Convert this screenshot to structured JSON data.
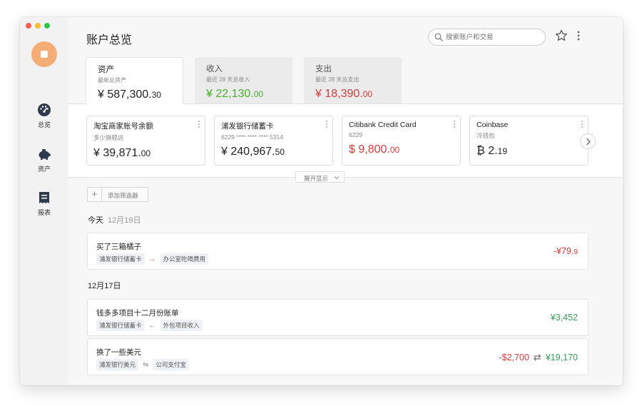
{
  "page_title": "账户总览",
  "search": {
    "placeholder": "搜索账户和交易"
  },
  "sidebar": {
    "items": [
      {
        "label": "总览",
        "icon": "dashboard-gauge-icon"
      },
      {
        "label": "资产",
        "icon": "piggy-bank-icon"
      },
      {
        "label": "报表",
        "icon": "receipt-report-icon"
      }
    ]
  },
  "tabs": [
    {
      "label": "资产",
      "sub": "最新总资产",
      "value_main": "¥ 587,300.",
      "value_dec": "30",
      "active": true
    },
    {
      "label": "收入",
      "sub": "最近 28 天总收入",
      "value_main": "¥ 22,130.",
      "value_dec": "00",
      "active": false
    },
    {
      "label": "支出",
      "sub": "最近 28 天总支出",
      "value_main": "¥ 18,390.",
      "value_dec": "00",
      "active": false
    }
  ],
  "accounts": [
    {
      "name": "淘宝商家账号余额",
      "sub": "多少旗舰店",
      "value_main": "¥ 39,871.",
      "value_dec": "00"
    },
    {
      "name": "浦发银行储蓄卡",
      "sub": "6229 **** **** **** 5314",
      "value_main": "¥ 240,967.",
      "value_dec": "50"
    },
    {
      "name": "Citibank Credit Card",
      "sub": "6229",
      "value_main": "$ 9,800.",
      "value_dec": "00"
    },
    {
      "name": "Coinbase",
      "sub": "冷钱包",
      "value_main": "₿ 2.",
      "value_dec": "19"
    }
  ],
  "expand_label": "展开显示",
  "add_filter_label": "添加筛选器",
  "groups": [
    {
      "title": "今天",
      "date": "12月19日"
    },
    {
      "title": "12月17日",
      "date": ""
    }
  ],
  "transactions": [
    {
      "name": "买了三箱橘子",
      "from": "浦发银行储蓄卡",
      "to": "办公室吃喝费用",
      "arrow": "→",
      "amount_main": "-¥79.",
      "amount_dec": "9"
    },
    {
      "name": "钱多多项目十二月份账单",
      "from": "浦发银行储蓄卡",
      "to": "外包项目收入",
      "arrow": "←",
      "amount_main": "¥3,452",
      "amount_dec": ""
    },
    {
      "name": "换了一些美元",
      "from": "浦发银行美元",
      "to": "公司支付宝",
      "arrow": "⇋",
      "amount_out": "-$2,700",
      "exchange": "⇄",
      "amount_in": "¥19,170"
    }
  ],
  "colors": {
    "income": "#4bac2f",
    "expense": "#d63a3a",
    "avatar": "#f4ad75",
    "positive_txn": "#3a9a5a"
  }
}
